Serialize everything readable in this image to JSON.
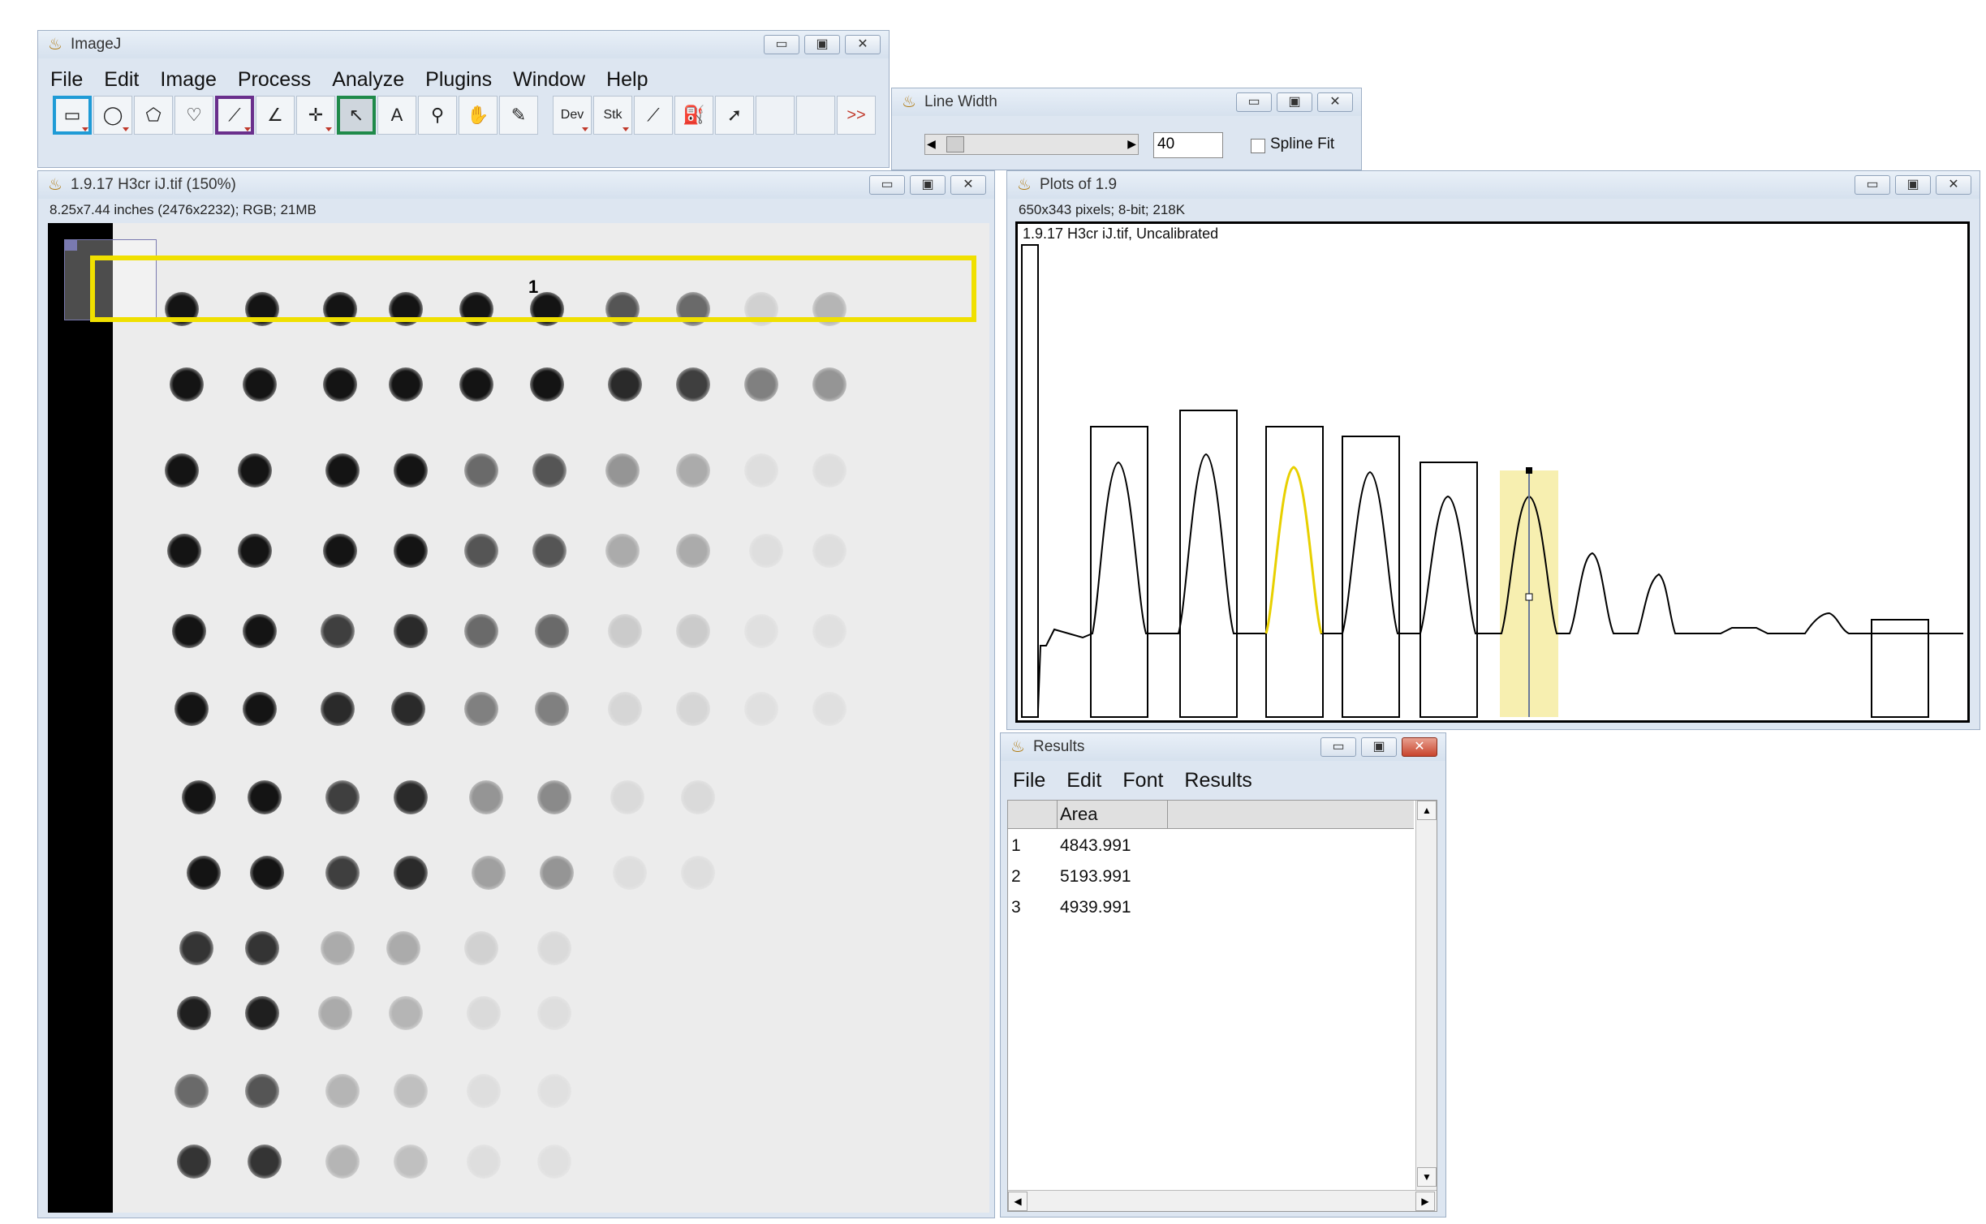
{
  "imagej": {
    "title": "ImageJ",
    "menu": [
      "File",
      "Edit",
      "Image",
      "Process",
      "Analyze",
      "Plugins",
      "Window",
      "Help"
    ],
    "tools": [
      {
        "name": "rectangle-tool",
        "glyph": "▭",
        "sel": "blue"
      },
      {
        "name": "oval-tool",
        "glyph": "◯"
      },
      {
        "name": "polygon-tool",
        "glyph": "⬠"
      },
      {
        "name": "freehand-tool",
        "glyph": "♡"
      },
      {
        "name": "straight-line-tool",
        "glyph": "⟋",
        "sel": "purple"
      },
      {
        "name": "angle-tool",
        "glyph": "∠"
      },
      {
        "name": "point-tool",
        "glyph": "✛"
      },
      {
        "name": "wand-tool",
        "glyph": "↖",
        "sel": "green"
      },
      {
        "name": "text-tool",
        "glyph": "A"
      },
      {
        "name": "magnifier-tool",
        "glyph": "⚲"
      },
      {
        "name": "hand-tool",
        "glyph": "✋"
      },
      {
        "name": "dropper-tool",
        "glyph": "✎"
      },
      {
        "name": "dev-tool",
        "glyph": "Dev"
      },
      {
        "name": "stk-tool",
        "glyph": "Stk"
      },
      {
        "name": "brush-tool",
        "glyph": "⟋"
      },
      {
        "name": "flood-fill-tool",
        "glyph": "⛽"
      },
      {
        "name": "pin-tool",
        "glyph": "➚"
      },
      {
        "name": "blank-tool-1",
        "glyph": ""
      },
      {
        "name": "blank-tool-2",
        "glyph": ""
      },
      {
        "name": "more-tools",
        "glyph": ">>"
      }
    ]
  },
  "line_width": {
    "title": "Line Width",
    "value": "40",
    "spline_label": "Spline Fit"
  },
  "image_window": {
    "title": "1.9.17 H3cr iJ.tif (150%)",
    "info": "8.25x7.44 inches (2476x2232); RGB; 21MB",
    "roi_label": "1"
  },
  "plot_window": {
    "title": "Plots of 1.9",
    "info": "650x343 pixels; 8-bit; 218K",
    "plot_caption": "1.9.17 H3cr iJ.tif, Uncalibrated"
  },
  "results": {
    "title": "Results",
    "menu": [
      "File",
      "Edit",
      "Font",
      "Results"
    ],
    "column": "Area",
    "rows": [
      {
        "n": "1",
        "area": "4843.991"
      },
      {
        "n": "2",
        "area": "5193.991"
      },
      {
        "n": "3",
        "area": "4939.991"
      }
    ]
  },
  "colors": {
    "highlight_yellow": "#f0e000",
    "peak_fill": "#f7efb0",
    "selection_blue": "#1f9bd6",
    "selection_purple": "#6a2f8c",
    "selection_green": "#1f8a4a"
  },
  "window_buttons": {
    "minimize": "▭",
    "maximize": "▣",
    "close": "✕"
  }
}
